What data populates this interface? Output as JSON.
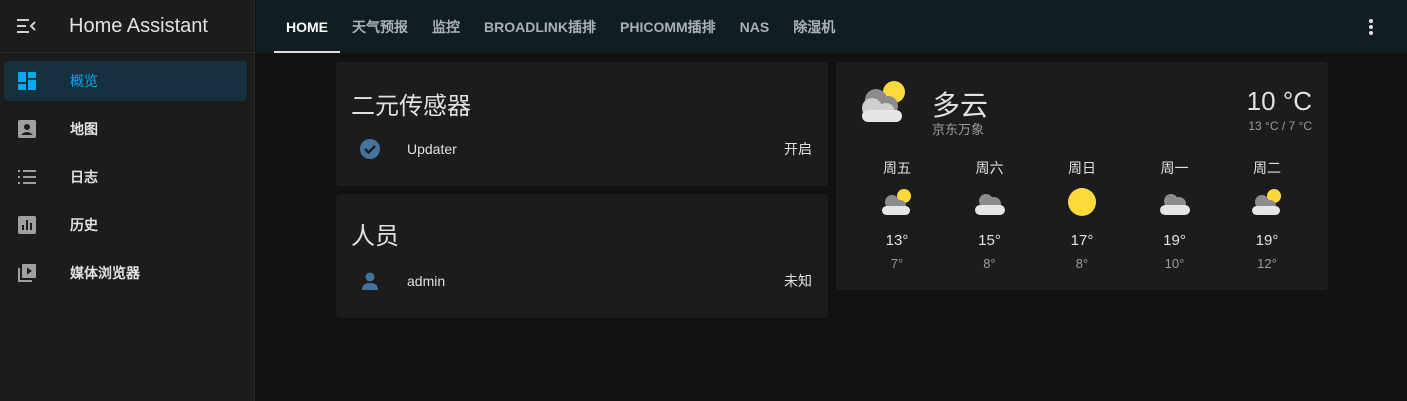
{
  "app": {
    "title": "Home Assistant"
  },
  "sidebar": {
    "items": [
      {
        "label": "概览",
        "icon": "dashboard-icon",
        "active": true
      },
      {
        "label": "地图",
        "icon": "account-box-icon"
      },
      {
        "label": "日志",
        "icon": "list-icon"
      },
      {
        "label": "历史",
        "icon": "chart-box-icon"
      },
      {
        "label": "媒体浏览器",
        "icon": "play-box-icon"
      }
    ]
  },
  "tabs": [
    {
      "label": "HOME",
      "active": true
    },
    {
      "label": "天气预报"
    },
    {
      "label": "监控"
    },
    {
      "label": "BROADLINK插排"
    },
    {
      "label": "PHICOMM插排"
    },
    {
      "label": "NAS"
    },
    {
      "label": "除湿机"
    }
  ],
  "binary_sensor_card": {
    "title": "二元传感器",
    "entity": {
      "name": "Updater",
      "state": "开启",
      "icon": "check-circle-icon"
    }
  },
  "person_card": {
    "title": "人员",
    "entity": {
      "name": "admin",
      "state": "未知",
      "icon": "account-icon"
    }
  },
  "weather": {
    "condition": "多云",
    "location": "京东万象",
    "temperature": "10 °C",
    "range": "13 °C / 7 °C",
    "icon": "partly-cloudy-icon",
    "forecast": [
      {
        "day": "周五",
        "icon": "partly-cloudy-icon",
        "high": "13°",
        "low": "7°"
      },
      {
        "day": "周六",
        "icon": "cloudy-icon",
        "high": "15°",
        "low": "8°"
      },
      {
        "day": "周日",
        "icon": "sunny-icon",
        "high": "17°",
        "low": "8°"
      },
      {
        "day": "周一",
        "icon": "cloudy-icon",
        "high": "19°",
        "low": "10°"
      },
      {
        "day": "周二",
        "icon": "partly-cloudy-icon",
        "high": "19°",
        "low": "12°"
      }
    ]
  },
  "colors": {
    "accent": "#03a9f4",
    "sun": "#fdd93c",
    "cloud": "#cfcfcf",
    "entity_icon": "#44739e"
  }
}
